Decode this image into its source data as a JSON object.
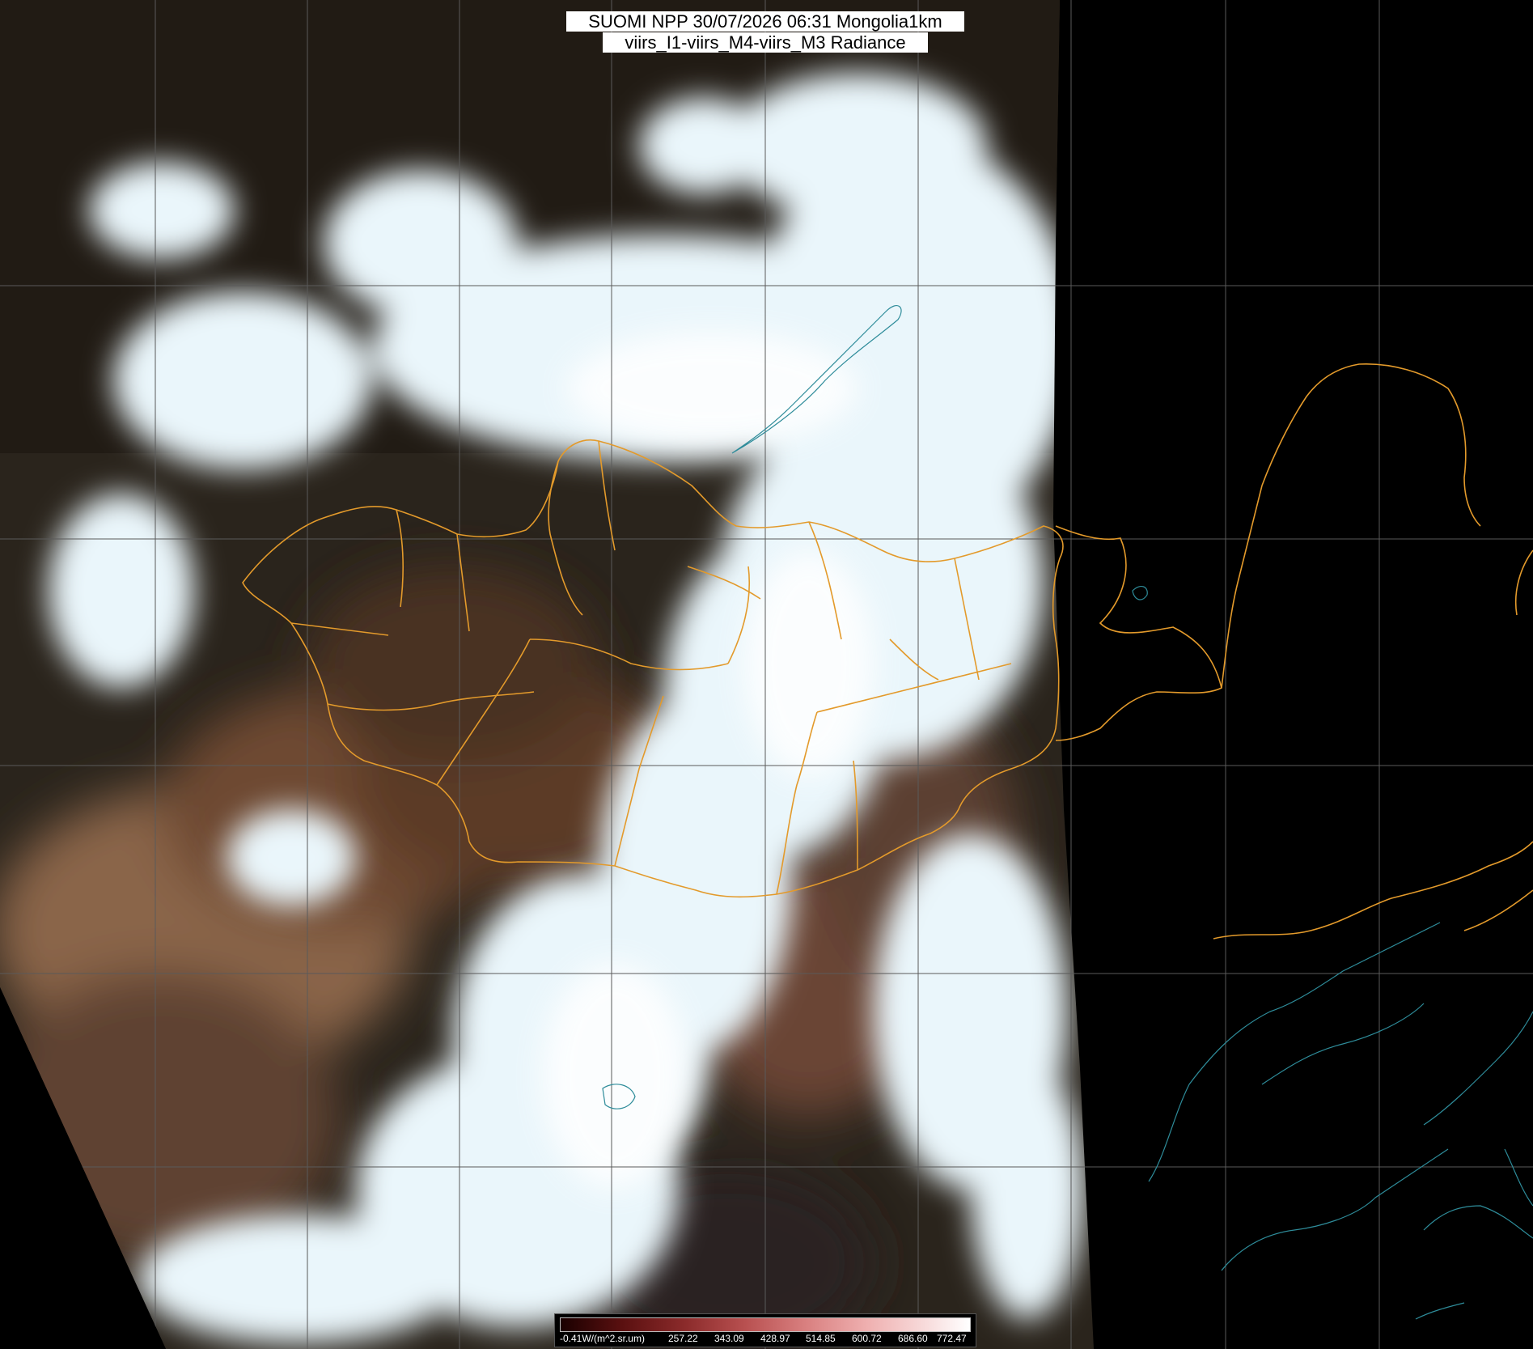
{
  "title": {
    "line1": "SUOMI NPP 30/07/2026 06:31 Mongolia1km",
    "line2": "viirs_I1-viirs_M4-viirs_M3 Radiance"
  },
  "legend": {
    "unit_label": "-0.41W/(m^2.sr.um)",
    "ticks": [
      "257.22",
      "343.09",
      "428.97",
      "514.85",
      "600.72",
      "686.60",
      "772.47"
    ],
    "colors": [
      "#1a0000",
      "#5a1010",
      "#8a2a2a",
      "#b85050",
      "#d98080",
      "#efb0b0",
      "#f8dede",
      "#ffffff"
    ]
  },
  "colors": {
    "background": "#000000",
    "graticule": "#5a5a5a",
    "border": "#e39a2b",
    "coastline": "#2e8c9a",
    "cloud": "#eaf6fb",
    "land_desert": "#6b4a34",
    "land_forest": "#1f1a14"
  },
  "icons": {
    "map": "satellite-image",
    "borders": "admin-border-lines",
    "coast": "coastline-lines"
  }
}
